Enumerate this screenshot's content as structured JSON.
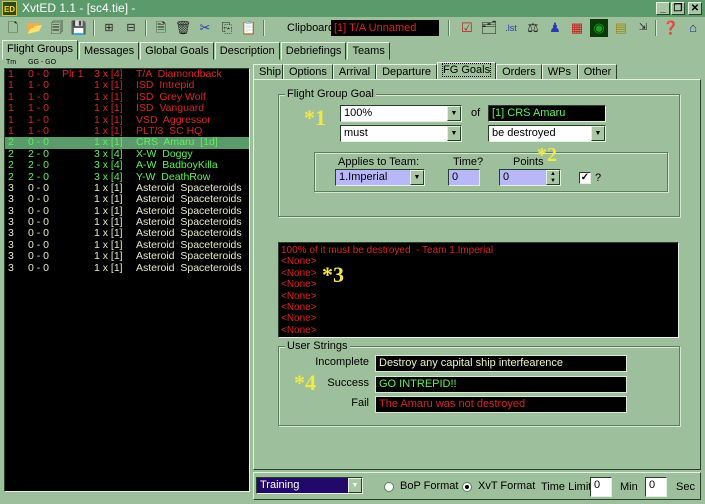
{
  "window": {
    "title": "XvtED 1.1 - [sc4.tie] -",
    "icon_text": "ED",
    "controls": [
      "minimize",
      "restore",
      "close"
    ]
  },
  "toolbar": {
    "left_icons": [
      "new-file-icon",
      "open-folder-icon",
      "save-as-icon",
      "save-icon",
      "move-up-icon",
      "move-down-icon",
      "new-flightgroup-icon",
      "delete-icon",
      "cut-icon",
      "copy-icon",
      "paste-icon"
    ],
    "clipboard_label": "Clipboard:",
    "clipboard_value": "[1] T/A Unnamed",
    "right_icons": [
      "mission-check-icon",
      "briefing-icon",
      "list-icon",
      "balance-icon",
      "pilot-icon",
      "grid-map-icon",
      "globe-icon",
      "archive-icon",
      "resize-icon",
      "help-icon",
      "home-icon"
    ],
    "right_icon_labels": {
      "list": ".lst"
    }
  },
  "main_tabs": [
    "Flight Groups",
    "Messages",
    "Global Goals",
    "Description",
    "Debriefings",
    "Teams"
  ],
  "main_tab_active": 0,
  "flight_list": {
    "header_team": "Tm",
    "header_gg": "GG - GO",
    "rows": [
      {
        "team": "1",
        "gg": "0 - 0",
        "plr": "Plr 1",
        "count": "3 x [4]",
        "name": "T/A  Diamondback",
        "color": "#d9242a"
      },
      {
        "team": "1",
        "gg": "1 - 0",
        "plr": "",
        "count": "1 x [1]",
        "name": "ISD  Intrepid",
        "color": "#d9242a"
      },
      {
        "team": "1",
        "gg": "1 - 0",
        "plr": "",
        "count": "1 x [1]",
        "name": "ISD  Grey Wolf",
        "color": "#d9242a"
      },
      {
        "team": "1",
        "gg": "1 - 0",
        "plr": "",
        "count": "1 x [1]",
        "name": "ISD  Vanguard",
        "color": "#d9242a"
      },
      {
        "team": "1",
        "gg": "1 - 0",
        "plr": "",
        "count": "1 x [1]",
        "name": "VSD  Aggressor",
        "color": "#d9242a"
      },
      {
        "team": "1",
        "gg": "1 - 0",
        "plr": "",
        "count": "1 x [1]",
        "name": "PLT/3  SC HQ",
        "color": "#d9242a"
      },
      {
        "team": "2",
        "gg": "0 - 0",
        "plr": "",
        "count": "1 x [1]",
        "name": "CRS  Amaru  [1d]",
        "color": "#5ef05e",
        "selected": true
      },
      {
        "team": "2",
        "gg": "2 - 0",
        "plr": "",
        "count": "3 x [4]",
        "name": "X-W  Doggy",
        "color": "#5ef05e"
      },
      {
        "team": "2",
        "gg": "2 - 0",
        "plr": "",
        "count": "3 x [4]",
        "name": "A-W  BadboyKilla",
        "color": "#5ef05e"
      },
      {
        "team": "2",
        "gg": "2 - 0",
        "plr": "",
        "count": "3 x [4]",
        "name": "Y-W  DeathRow",
        "color": "#5ef05e"
      },
      {
        "team": "3",
        "gg": "0 - 0",
        "plr": "",
        "count": "1 x [1]",
        "name": "Asteroid  Spaceteroids",
        "color": "#e8e8c8"
      },
      {
        "team": "3",
        "gg": "0 - 0",
        "plr": "",
        "count": "1 x [1]",
        "name": "Asteroid  Spaceteroids",
        "color": "#e8e8c8"
      },
      {
        "team": "3",
        "gg": "0 - 0",
        "plr": "",
        "count": "1 x [1]",
        "name": "Asteroid  Spaceteroids",
        "color": "#e8e8c8"
      },
      {
        "team": "3",
        "gg": "0 - 0",
        "plr": "",
        "count": "1 x [1]",
        "name": "Asteroid  Spaceteroids",
        "color": "#e8e8c8"
      },
      {
        "team": "3",
        "gg": "0 - 0",
        "plr": "",
        "count": "1 x [1]",
        "name": "Asteroid  Spaceteroids",
        "color": "#e8e8c8"
      },
      {
        "team": "3",
        "gg": "0 - 0",
        "plr": "",
        "count": "1 x [1]",
        "name": "Asteroid  Spaceteroids",
        "color": "#e8e8c8"
      },
      {
        "team": "3",
        "gg": "0 - 0",
        "plr": "",
        "count": "1 x [1]",
        "name": "Asteroid  Spaceteroids",
        "color": "#e8e8c8"
      },
      {
        "team": "3",
        "gg": "0 - 0",
        "plr": "",
        "count": "1 x [1]",
        "name": "Asteroid  Spaceteroids",
        "color": "#e8e8c8"
      }
    ]
  },
  "sub_tabs": [
    "Ship",
    "Options",
    "Arrival",
    "Departure",
    "FG Goals",
    "Orders",
    "WPs",
    "Other"
  ],
  "sub_tab_active": 4,
  "fg_goal": {
    "group_label": "Flight Group Goal",
    "amount": "100%",
    "of_label": "of",
    "target": "[1] CRS Amaru",
    "must": "must",
    "condition": "be destroyed",
    "applies_label": "Applies to Team:",
    "team": "1.Imperial",
    "time_label": "Time?",
    "time_value": "0",
    "points_label": "Points",
    "points_value": "0",
    "checkbox_checked": true,
    "checkbox_label": "?"
  },
  "goal_summary": [
    "100% of it must be destroyed  - Team 1.Imperial",
    "<None>",
    "<None>",
    "<None>",
    "<None>",
    "<None>",
    "<None>",
    "<None>"
  ],
  "user_strings": {
    "group_label": "User Strings",
    "incomplete_label": "Incomplete",
    "incomplete": "Destroy any capital ship interfearence",
    "incomplete_color": "#f0f0c0",
    "success_label": "Success",
    "success": "GO INTREPID!!",
    "success_color": "#5ef05e",
    "fail_label": "Fail",
    "fail": "The Amaru was not destroyed",
    "fail_color": "#d9242a"
  },
  "annotations": [
    "*1",
    "*2",
    "*3",
    "*4"
  ],
  "bottom": {
    "mission_type": "Training",
    "bop_label": "BoP Format",
    "xvt_label": "XvT Format",
    "format_selected": "XvT Format",
    "time_limit_label": "Time Limit:",
    "min_value": "0",
    "min_label": "Min",
    "sec_value": "0",
    "sec_label": "Sec"
  }
}
